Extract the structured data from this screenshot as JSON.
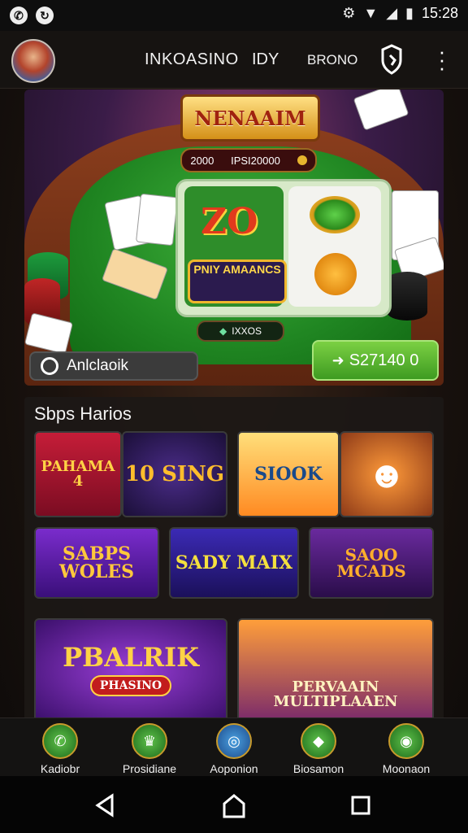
{
  "status_bar": {
    "time": "15:28",
    "icons": [
      "whatsapp-icon",
      "sync-icon",
      "settings-icon",
      "wifi-icon",
      "signal-icon",
      "battery-icon"
    ]
  },
  "app_bar": {
    "title": "INKOASINO",
    "subtitle": "IDY",
    "account": "BRONO",
    "icons": [
      "avatar",
      "shield-icon",
      "more-vert-icon"
    ]
  },
  "hero": {
    "logo": "NENAAIM",
    "jackpot_left": "2000",
    "jackpot_right": "IPSI20000",
    "slot_symbol": "ZO",
    "slot_button": "PNIY AMAANCS",
    "win_amount": "IXXOS",
    "label": "Anlclaoik",
    "balance": "S27140 0"
  },
  "section": {
    "title": "Sbps Harios",
    "tiles": [
      {
        "id": "tile-1",
        "text": "PAHAMA 4"
      },
      {
        "id": "tile-2",
        "text": "10 SING"
      },
      {
        "id": "tile-3",
        "text": "SIOOK"
      },
      {
        "id": "tile-4",
        "text": "SABPS WOLES"
      },
      {
        "id": "tile-5",
        "text": "SADY MAIX"
      },
      {
        "id": "tile-6",
        "text": "SAOO MCADS"
      },
      {
        "id": "tile-7",
        "text": "PBALRIK"
      },
      {
        "id": "tile-7b",
        "text": "PHASINO"
      },
      {
        "id": "tile-8",
        "text": "PERVAAIN MULTIPLAAEN"
      }
    ]
  },
  "bottom_nav": [
    {
      "label": "Kadiobr",
      "icon": "phone-icon"
    },
    {
      "label": "Prosidiane",
      "icon": "crown-icon"
    },
    {
      "label": "Aoponion",
      "icon": "target-icon"
    },
    {
      "label": "Biosamon",
      "icon": "gem-icon"
    },
    {
      "label": "Moonaon",
      "icon": "ring-icon"
    }
  ],
  "system_nav": [
    "back-icon",
    "home-icon",
    "recents-icon"
  ],
  "colors": {
    "accent_green": "#4aa82a",
    "gold": "#f0b62c",
    "felt": "#208622"
  }
}
